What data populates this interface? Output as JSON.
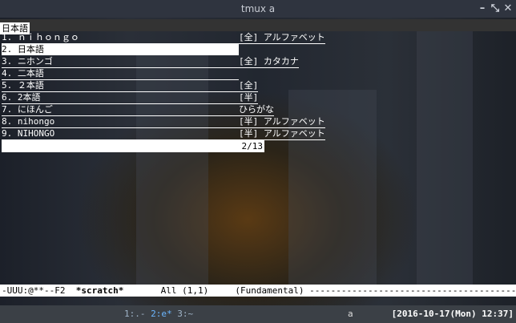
{
  "window": {
    "title": "tmux a",
    "buttons": [
      "minimize",
      "maximize",
      "close"
    ]
  },
  "header": {
    "input": "日本語"
  },
  "candidates": [
    {
      "label": "1. ｎｉｈｏｎｇｏ",
      "note": "[全] アルファベット"
    },
    {
      "label": "2. 日本語",
      "note": "",
      "selected": true
    },
    {
      "label": "3. ニホンゴ",
      "note": "[全] カタカナ"
    },
    {
      "label": "4. 二本語",
      "note": ""
    },
    {
      "label": "5. ２本語",
      "note": "[全]"
    },
    {
      "label": "6. 2本語",
      "note": "[半]"
    },
    {
      "label": "7. にほんご",
      "note": "ひらがな"
    },
    {
      "label": "8. nihongo",
      "note": "[半] アルファベット"
    },
    {
      "label": "9. NIHONGO",
      "note": "[半] アルファベット"
    }
  ],
  "counter": "2/13",
  "modeline": {
    "prefix": "-UUU:@**--F2  ",
    "buffer": "*scratch*",
    "pos": "       All (1,1)     (Fundamental) ",
    "fill": "-------------------------------------------"
  },
  "tmux": {
    "windows": [
      {
        "label": "1:.-",
        "active": false
      },
      {
        "label": "2:e*",
        "active": true
      },
      {
        "label": "3:~",
        "active": false
      }
    ],
    "session": "a",
    "clock": "[2016-10-17(Mon) 12:37]"
  }
}
